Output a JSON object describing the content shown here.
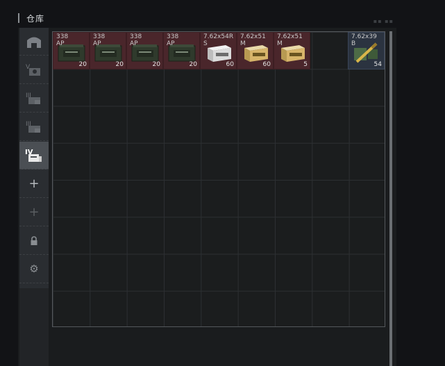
{
  "header": {
    "title": "仓库"
  },
  "sidebar": {
    "buttons": [
      {
        "icon": "stash-overview-icon",
        "label": ""
      },
      {
        "icon": "stash-level-v-icon",
        "label": "V"
      },
      {
        "icon": "stash-level-iii-icon",
        "label": "III"
      },
      {
        "icon": "stash-level-iii-b-icon",
        "label": "III"
      },
      {
        "icon": "stash-level-iv-icon",
        "label": "IV"
      },
      {
        "icon": "add-icon",
        "label": "+"
      },
      {
        "icon": "add-disabled-icon",
        "label": "+"
      },
      {
        "icon": "lock-icon",
        "label": ""
      },
      {
        "icon": "gear-icon",
        "label": ""
      }
    ]
  },
  "items": [
    {
      "caliber": "338",
      "type": "AP",
      "count": "20",
      "style": "ammo-can",
      "bg": "red"
    },
    {
      "caliber": "338",
      "type": "AP",
      "count": "20",
      "style": "ammo-can",
      "bg": "red"
    },
    {
      "caliber": "338",
      "type": "AP",
      "count": "20",
      "style": "ammo-can",
      "bg": "red"
    },
    {
      "caliber": "338",
      "type": "AP",
      "count": "20",
      "style": "ammo-can",
      "bg": "red"
    },
    {
      "caliber": "7.62x54R",
      "type": "S",
      "count": "60",
      "style": "white-box",
      "bg": "red"
    },
    {
      "caliber": "7.62x51",
      "type": "M",
      "count": "60",
      "style": "yellow-box",
      "bg": "red"
    },
    {
      "caliber": "7.62x51",
      "type": "M",
      "count": "5",
      "style": "yellow-box",
      "bg": "red"
    },
    {
      "caliber": "7.62x39",
      "type": "B",
      "count": "54",
      "style": "rounds",
      "bg": "blue"
    }
  ],
  "colors": {
    "accent_red": "#4a262b",
    "accent_blue": "#2b3340"
  }
}
